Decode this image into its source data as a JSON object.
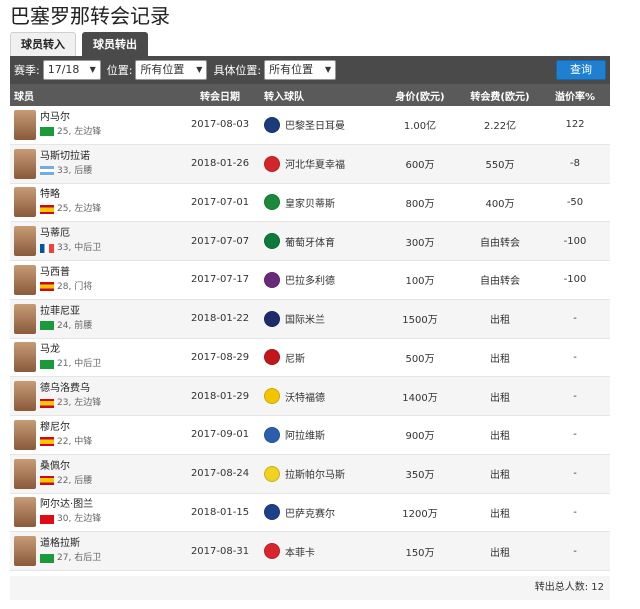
{
  "page": {
    "title": "巴塞罗那转会记录"
  },
  "tabs": [
    {
      "label": "球员转入",
      "active": false
    },
    {
      "label": "球员转出",
      "active": true
    }
  ],
  "filters": {
    "season_label": "赛季:",
    "season_value": "17/18",
    "position_label": "位置:",
    "position_value": "所有位置",
    "detail_label": "具体位置:",
    "detail_value": "所有位置",
    "query_button": "查询"
  },
  "columns": [
    "球员",
    "转会日期",
    "转入球队",
    "身价(欧元)",
    "转会费(欧元)",
    "溢价率%"
  ],
  "rows": [
    {
      "name": "内马尔",
      "age": "25",
      "position": "左边锋",
      "nation_flag": "brazil-flag",
      "date": "2017-08-03",
      "team": "巴黎圣日耳曼",
      "team_color": "#1b3b7a",
      "value": "1.00亿",
      "fee": "2.22亿",
      "premium": "122"
    },
    {
      "name": "马斯切拉诺",
      "age": "33",
      "position": "后腰",
      "nation_flag": "argentina-flag",
      "date": "2018-01-26",
      "team": "河北华夏幸福",
      "team_color": "#d3262a",
      "value": "600万",
      "fee": "550万",
      "premium": "-8"
    },
    {
      "name": "特略",
      "age": "25",
      "position": "左边锋",
      "nation_flag": "spain-flag",
      "date": "2017-07-01",
      "team": "皇家贝蒂斯",
      "team_color": "#1a8a3a",
      "value": "800万",
      "fee": "400万",
      "premium": "-50"
    },
    {
      "name": "马蒂厄",
      "age": "33",
      "position": "中后卫",
      "nation_flag": "france-flag",
      "date": "2017-07-07",
      "team": "葡萄牙体育",
      "team_color": "#0e7a3a",
      "value": "300万",
      "fee": "自由转会",
      "premium": "-100"
    },
    {
      "name": "马西普",
      "age": "28",
      "position": "门将",
      "nation_flag": "spain-flag",
      "date": "2017-07-17",
      "team": "巴拉多利德",
      "team_color": "#6a2a7a",
      "value": "100万",
      "fee": "自由转会",
      "premium": "-100"
    },
    {
      "name": "拉菲尼亚",
      "age": "24",
      "position": "前腰",
      "nation_flag": "brazil-flag",
      "date": "2018-01-22",
      "team": "国际米兰",
      "team_color": "#1c2c6b",
      "value": "1500万",
      "fee": "出租",
      "premium": "-"
    },
    {
      "name": "马龙",
      "age": "21",
      "position": "中后卫",
      "nation_flag": "brazil-flag",
      "date": "2017-08-29",
      "team": "尼斯",
      "team_color": "#c2161c",
      "value": "500万",
      "fee": "出租",
      "premium": "-"
    },
    {
      "name": "德乌洛费乌",
      "age": "23",
      "position": "左边锋",
      "nation_flag": "spain-flag",
      "date": "2018-01-29",
      "team": "沃特福德",
      "team_color": "#f2c500",
      "value": "1400万",
      "fee": "出租",
      "premium": "-"
    },
    {
      "name": "穆尼尔",
      "age": "22",
      "position": "中锋",
      "nation_flag": "spain-flag",
      "date": "2017-09-01",
      "team": "阿拉维斯",
      "team_color": "#2a5fb0",
      "value": "900万",
      "fee": "出租",
      "premium": "-"
    },
    {
      "name": "桑佩尔",
      "age": "22",
      "position": "后腰",
      "nation_flag": "spain-flag",
      "date": "2017-08-24",
      "team": "拉斯帕尔马斯",
      "team_color": "#f0d020",
      "value": "350万",
      "fee": "出租",
      "premium": "-"
    },
    {
      "name": "阿尔达·图兰",
      "age": "30",
      "position": "左边锋",
      "nation_flag": "turkey-flag",
      "date": "2018-01-15",
      "team": "巴萨克赛尔",
      "team_color": "#1f3f8a",
      "value": "1200万",
      "fee": "出租",
      "premium": "-"
    },
    {
      "name": "道格拉斯",
      "age": "27",
      "position": "右后卫",
      "nation_flag": "brazil-flag",
      "date": "2017-08-31",
      "team": "本菲卡",
      "team_color": "#d9262c",
      "value": "150万",
      "fee": "出租",
      "premium": "-"
    }
  ],
  "footer": {
    "total_label": "转出总人数:",
    "total_value": "12"
  },
  "colors": {
    "header_bg": "#4a4a4a",
    "query_button": "#1f7fd1",
    "row_alt": "#f5f5f5"
  }
}
